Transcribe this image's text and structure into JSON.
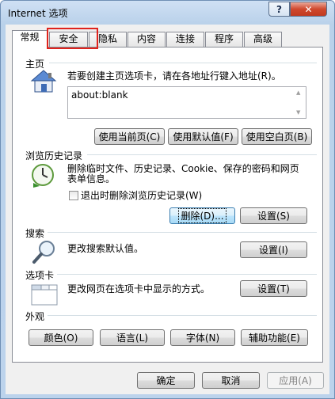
{
  "window": {
    "title": "Internet 选项",
    "help_glyph": "?",
    "close_glyph": "✕"
  },
  "tabs": [
    {
      "label": "常规",
      "active": true
    },
    {
      "label": "安全"
    },
    {
      "label": "隐私"
    },
    {
      "label": "内容"
    },
    {
      "label": "连接"
    },
    {
      "label": "程序"
    },
    {
      "label": "高级"
    }
  ],
  "home": {
    "title": "主页",
    "description": "若要创建主页选项卡，请在各地址行键入地址(R)。",
    "value": "about:blank",
    "buttons": {
      "current": "使用当前页(C)",
      "default": "使用默认值(F)",
      "blank": "使用空白页(B)"
    }
  },
  "history": {
    "title": "浏览历史记录",
    "description_line1": "删除临时文件、历史记录、Cookie、保存的密码和网页",
    "description_line2": "表单信息。",
    "checkbox_label": "退出时删除浏览历史记录(W)",
    "delete_button": "删除(D)...",
    "settings_button": "设置(S)"
  },
  "search": {
    "title": "搜索",
    "description": "更改搜索默认值。",
    "settings_button": "设置(I)"
  },
  "tabs_section": {
    "title": "选项卡",
    "description": "更改网页在选项卡中显示的方式。",
    "settings_button": "设置(T)"
  },
  "appearance": {
    "title": "外观",
    "buttons": {
      "colors": "颜色(O)",
      "languages": "语言(L)",
      "fonts": "字体(N)",
      "accessibility": "辅助功能(E)"
    }
  },
  "footer": {
    "ok": "确定",
    "cancel": "取消",
    "apply": "应用(A)"
  }
}
